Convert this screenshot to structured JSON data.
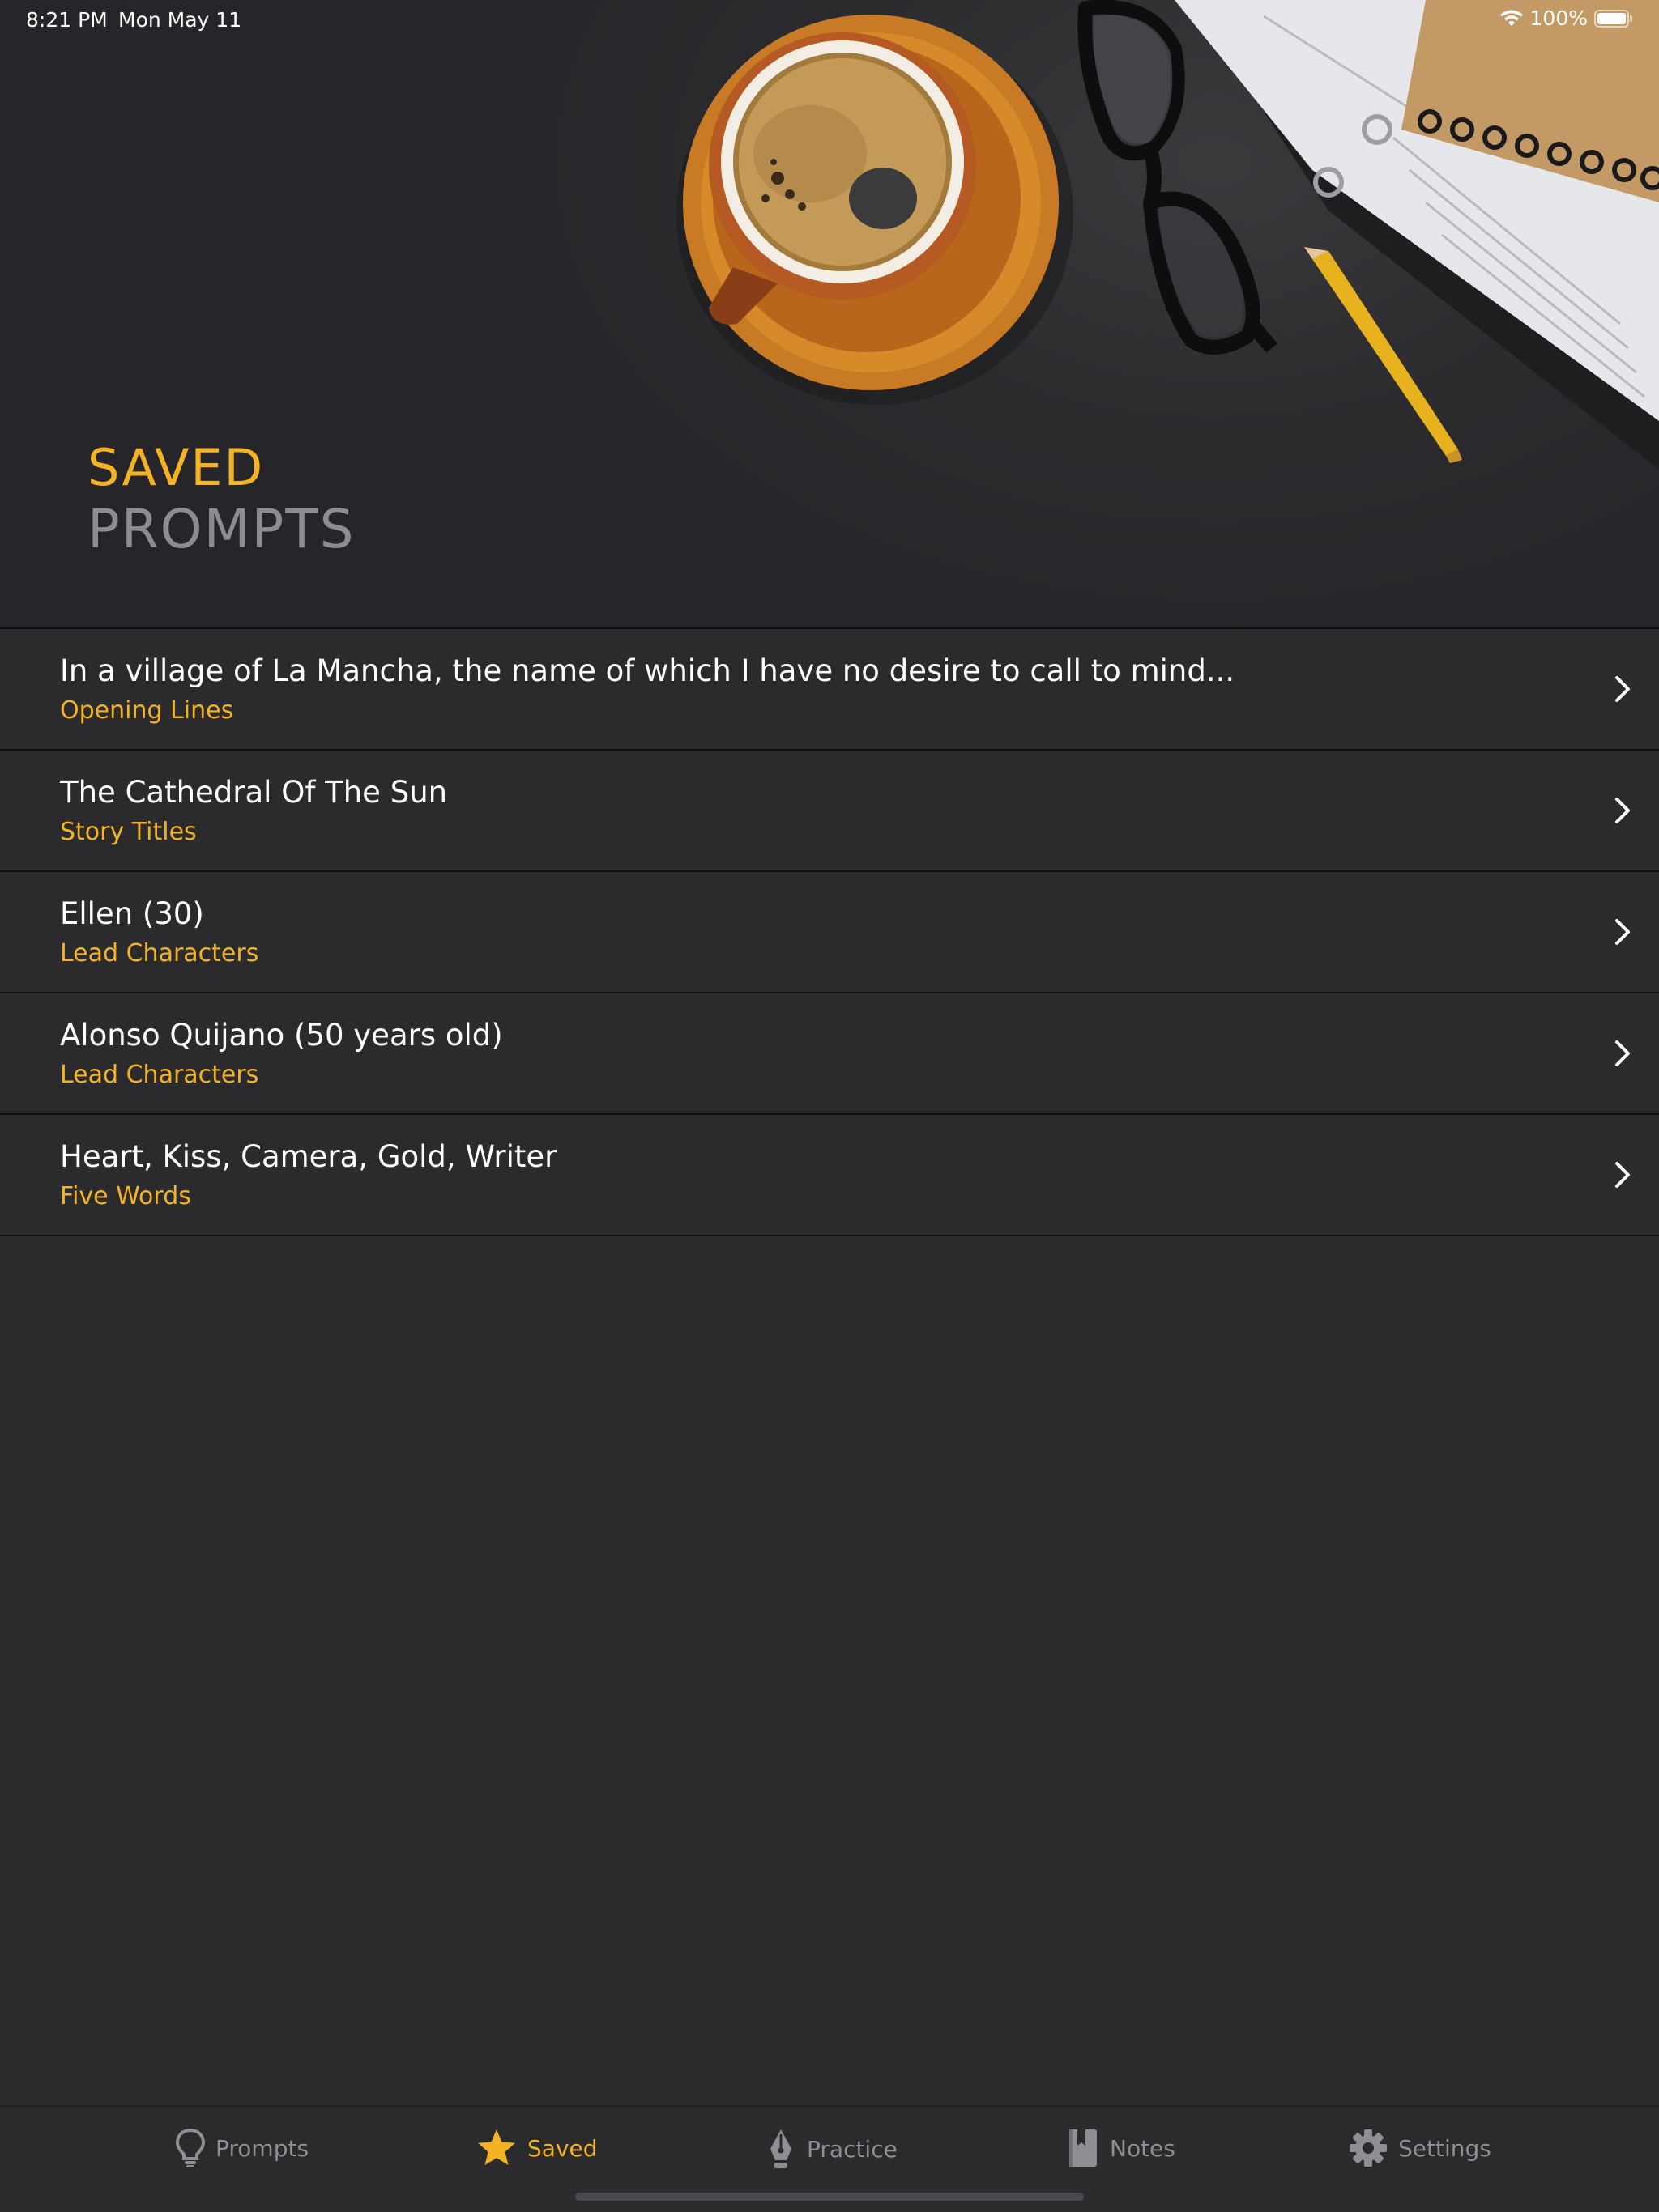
{
  "status_bar": {
    "time": "8:21 PM",
    "date": "Mon May 11",
    "battery": "100%"
  },
  "header": {
    "title_line1": "SAVED",
    "title_line2": "PROMPTS"
  },
  "items": [
    {
      "title": "In a village of La Mancha, the name of which I have no desire to call to mind...",
      "category": "Opening Lines"
    },
    {
      "title": "The Cathedral Of The Sun",
      "category": "Story Titles"
    },
    {
      "title": "Ellen (30)",
      "category": "Lead Characters"
    },
    {
      "title": "Alonso Quijano (50 years old)",
      "category": "Lead Characters"
    },
    {
      "title": "Heart, Kiss, Camera, Gold, Writer",
      "category": "Five Words"
    }
  ],
  "tabs": [
    {
      "label": "Prompts",
      "icon": "lightbulb-icon"
    },
    {
      "label": "Saved",
      "icon": "star-icon",
      "active": true
    },
    {
      "label": "Practice",
      "icon": "pen-nib-icon"
    },
    {
      "label": "Notes",
      "icon": "notebook-icon"
    },
    {
      "label": "Settings",
      "icon": "gear-icon"
    }
  ],
  "colors": {
    "accent": "#f4b324",
    "background": "#2b2b2e",
    "muted": "#8e8e93",
    "separator": "#0f0f11"
  }
}
